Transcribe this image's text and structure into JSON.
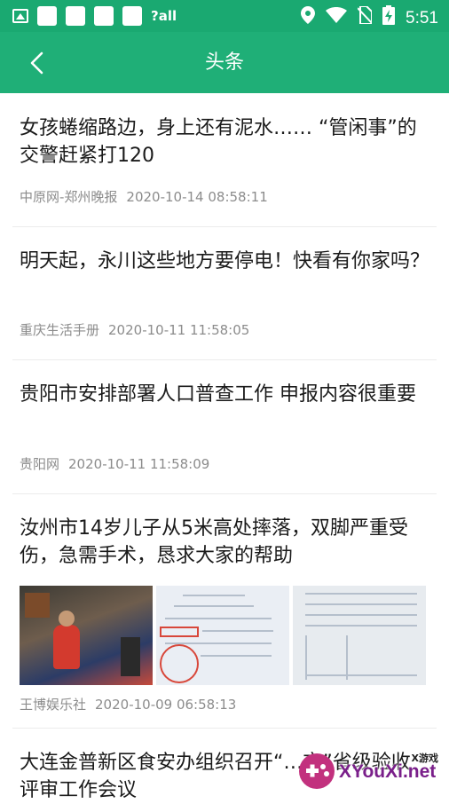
{
  "status_bar": {
    "time": "5:51",
    "signal_text": "?all"
  },
  "header": {
    "title": "头条"
  },
  "news": [
    {
      "title": "女孩蜷缩路边，身上还有泥水…… “管闲事”的交警赶紧打120",
      "source": "中原网-郑州晚报",
      "time": "2020-10-14 08:58:11"
    },
    {
      "title": "明天起，永川这些地方要停电！快看有你家吗？",
      "source": "重庆生活手册",
      "time": "2020-10-11 11:58:05"
    },
    {
      "title": "贵阳市安排部署人口普查工作 申报内容很重要",
      "source": "贵阳网",
      "time": "2020-10-11 11:58:09"
    },
    {
      "title": "汝州市14岁儿子从5米高处摔落，双脚严重受伤，急需手术，恳求大家的帮助",
      "source": "王博娱乐社",
      "time": "2020-10-09 06:58:13"
    },
    {
      "title": "大连金普新区食安办组织召开“…市”省级验收评审工作会议",
      "source": "",
      "time": ""
    }
  ],
  "watermark": {
    "brand": "XYouXi.net",
    "sub": "X游戏"
  },
  "colors": {
    "status_bar": "#1aa971",
    "header": "#1faf77",
    "title_text": "#1a1a1a",
    "meta_text": "#8c8c8c"
  },
  "icons": {
    "back": "chevron-left-icon",
    "status": [
      "gallery-icon",
      "notification-box-icon",
      "signal-icon",
      "location-icon",
      "wifi-icon",
      "no-sim-icon",
      "battery-charging-icon"
    ]
  }
}
